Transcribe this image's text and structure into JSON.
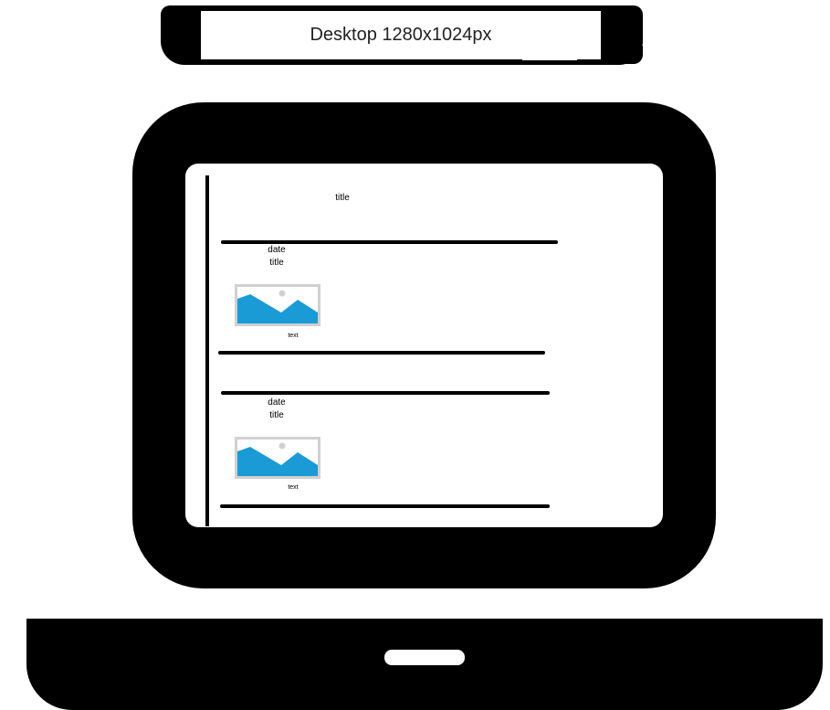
{
  "banner": {
    "label": "Desktop 1280x1024px"
  },
  "page": {
    "title": "title",
    "posts": [
      {
        "date": "date",
        "title": "title",
        "image": "image-placeholder-icon",
        "text": "text"
      },
      {
        "date": "date",
        "title": "title",
        "image": "image-placeholder-icon",
        "text": "text"
      }
    ]
  },
  "colors": {
    "frame": "#000000",
    "screen": "#ffffff",
    "image_mountain": "#1a9bd6",
    "image_border": "#d0d0d0"
  }
}
